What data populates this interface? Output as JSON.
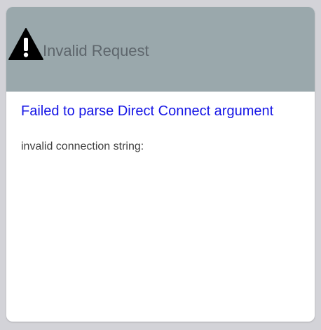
{
  "dialog": {
    "title": "Invalid Request",
    "icon": "warning-icon",
    "header_color": "#9aa8ac",
    "error_heading": "Failed to parse Direct Connect argument",
    "error_heading_color": "#1515e6",
    "error_detail": "invalid connection string:"
  }
}
